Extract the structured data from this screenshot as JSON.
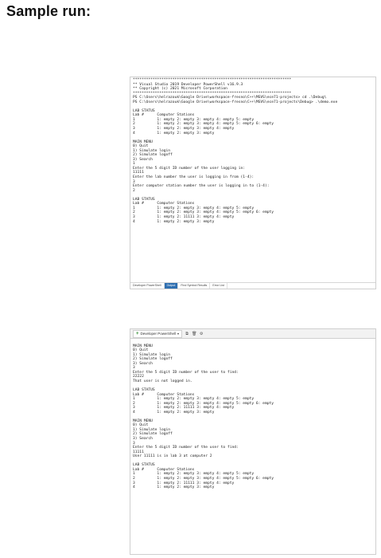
{
  "heading": "Sample run:",
  "terminal1": {
    "lines": [
      "************************************************************************",
      "** Visual Studio 2019 Developer PowerShell v16.9.3",
      "** Copyright (c) 2021 Microsoft Corporation",
      "************************************************************************",
      "PS C:\\Users\\helrazouk\\Google Drive\\workspace-fresno\\C++\\MSVS\\ece71-projects> cd .\\Debug\\",
      "PS C:\\Users\\helrazouk\\Google Drive\\workspace-fresno\\C++\\MSVS\\ece71-projects\\Debug> .\\demo.exe",
      "",
      "LAB STATUS",
      "Lab #      Computer Stations",
      "1          1: empty 2: empty 3: empty 4: empty 5: empty",
      "2          1: empty 2: empty 3: empty 4: empty 5: empty 6: empty",
      "3          1: empty 2: empty 3: empty 4: empty",
      "4          1: empty 2: empty 3: empty",
      "",
      "MAIN MENU",
      "0) Quit",
      "1) Simulate login",
      "2) Simulate logoff",
      "3) Search",
      "1",
      "Enter the 5 digit ID number of the user logging in:",
      "11111",
      "Enter the lab number the user is logging in from (1-4):",
      "3",
      "Enter computer station number the user is logging in to (1-4):",
      "2",
      "",
      "LAB STATUS",
      "Lab #      Computer Stations",
      "1          1: empty 2: empty 3: empty 4: empty 5: empty",
      "2          1: empty 2: empty 3: empty 4: empty 5: empty 6: empty",
      "3          1: empty 2: 11111 3: empty 4: empty",
      "4          1: empty 2: empty 3: empty"
    ],
    "taskbar": [
      "Developer PowerShell",
      "Output",
      "Find Symbol Results",
      "Error List"
    ]
  },
  "terminal2": {
    "tab_label": "Developer PowerShell",
    "lines": [
      "",
      "MAIN MENU",
      "0) Quit",
      "1) Simulate login",
      "2) Simulate logoff",
      "3) Search",
      "3",
      "Enter the 5 digit ID number of the user to find:",
      "22222",
      "That user is not logged in.",
      "",
      "LAB STATUS",
      "Lab #      Computer Stations",
      "1          1: empty 2: empty 3: empty 4: empty 5: empty",
      "2          1: empty 2: empty 3: empty 4: empty 5: empty 6: empty",
      "3          1: empty 2: 11111 3: empty 4: empty",
      "4          1: empty 2: empty 3: empty",
      "",
      "MAIN MENU",
      "0) Quit",
      "1) Simulate login",
      "2) Simulate logoff",
      "3) Search",
      "3",
      "Enter the 5 digit ID number of the user to find:",
      "11111",
      "User 11111 is in lab 3 at computer 2",
      "",
      "LAB STATUS",
      "Lab #      Computer Stations",
      "1          1: empty 2: empty 3: empty 4: empty 5: empty",
      "2          1: empty 2: empty 3: empty 4: empty 5: empty 6: empty",
      "3          1: empty 2: 11111 3: empty 4: empty",
      "4          1: empty 2: empty 3: empty"
    ]
  }
}
